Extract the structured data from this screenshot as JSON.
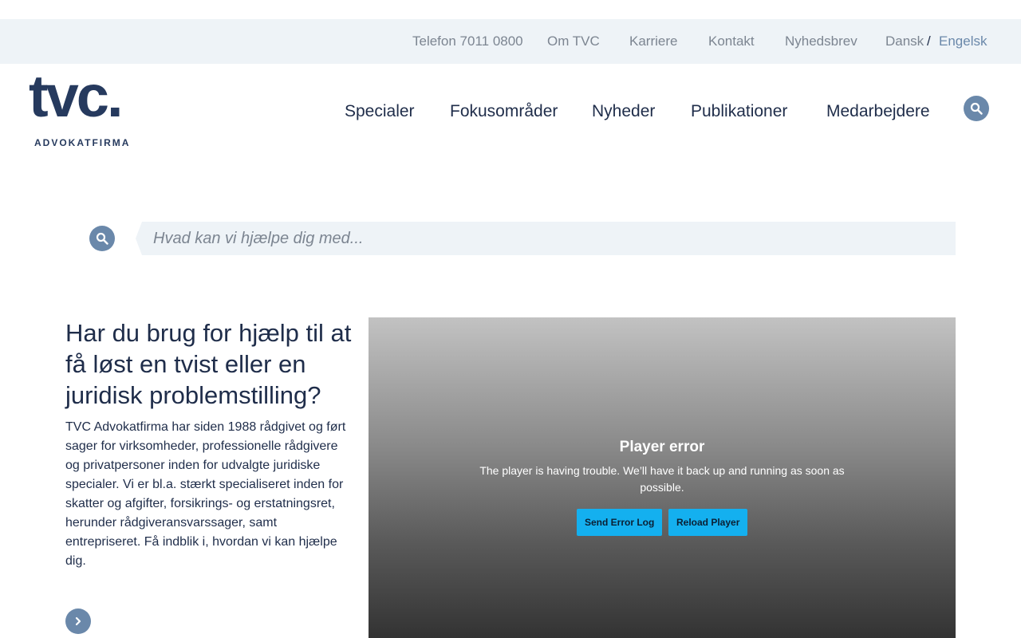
{
  "utility_nav": {
    "phone": "Telefon 7011 0800",
    "about": "Om TVC",
    "career": "Karriere",
    "contact": "Kontakt",
    "newsletter": "Nyhedsbrev",
    "lang_danish": "Dansk",
    "lang_separator": "/",
    "lang_english": "Engelsk"
  },
  "logo": {
    "wordmark": "tvc.",
    "tagline": "ADVOKATFIRMA"
  },
  "main_nav": {
    "items": [
      "Specialer",
      "Fokusområder",
      "Nyheder",
      "Publikationer",
      "Medarbejdere"
    ]
  },
  "search": {
    "placeholder": "Hvad kan vi hjælpe dig med...",
    "value": ""
  },
  "hero": {
    "title": "Har du brug for hjælp til at få løst en tvist eller en juridisk problemstilling?",
    "text": "TVC Advokatfirma har siden 1988 rådgivet og ført sager for virksomheder, professionelle rådgivere og privatpersoner inden for udvalgte juridiske specialer. Vi er bl.a. stærkt specialiseret inden for skatter og afgifter, forsikrings- og erstatningsret, herunder rådgiveransvarssager, samt entrepriseret. Få indblik i, hvordan vi kan hjælpe dig."
  },
  "player": {
    "error_title": "Player error",
    "error_message": "The player is having trouble. We’ll have it back up and running as soon as possible.",
    "send_log_label": "Send Error Log",
    "reload_label": "Reload Player"
  },
  "icons": {
    "header_search": "search-icon",
    "field_search": "search-icon",
    "more": "chevron-right-icon"
  },
  "colors": {
    "brand_navy": "#263a5e",
    "accent_blue": "#6a88aa",
    "utility_bg": "#eef3f7",
    "player_button": "#14b0ef"
  }
}
